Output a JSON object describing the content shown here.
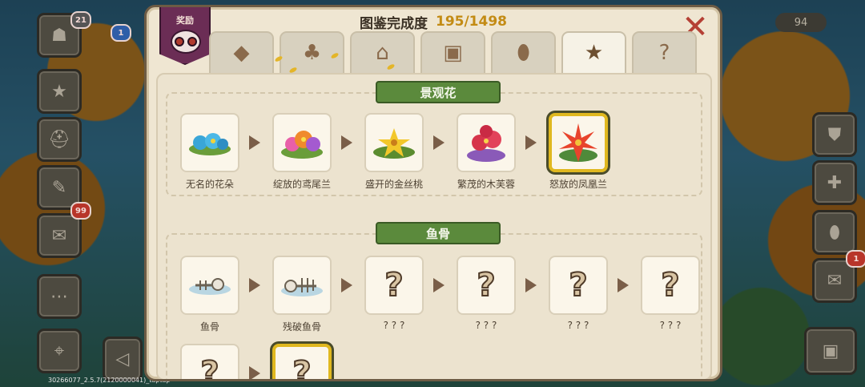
{
  "window": {
    "title": "图鉴完成度",
    "progress": "195/1498"
  },
  "reward": {
    "label": "奖励"
  },
  "background": {
    "hud_count": "94",
    "badges": [
      "21",
      "1",
      "99",
      "1"
    ],
    "version": "30266077_2.5.7(2120000041)_taptap"
  },
  "tabs": [
    {
      "icon": "gem-icon",
      "glyph": "◆",
      "active": false
    },
    {
      "icon": "clover-icon",
      "glyph": "♣",
      "active": false
    },
    {
      "icon": "house-icon",
      "glyph": "⌂",
      "active": false
    },
    {
      "icon": "chest-icon",
      "glyph": "▣",
      "active": false
    },
    {
      "icon": "egg-icon",
      "glyph": "⬮",
      "active": false
    },
    {
      "icon": "star-icon",
      "glyph": "★",
      "active": true
    },
    {
      "icon": "question-icon",
      "glyph": "?",
      "active": false
    }
  ],
  "sections": [
    {
      "title": "景观花",
      "items": [
        {
          "label": "无名的花朵",
          "known": true,
          "icon": "flower-blue-icon"
        },
        {
          "label": "绽放的鸢尾兰",
          "known": true,
          "icon": "flower-iris-icon"
        },
        {
          "label": "盛开的金丝桃",
          "known": true,
          "icon": "flower-gold-icon"
        },
        {
          "label": "繁茂的木芙蓉",
          "known": true,
          "icon": "flower-hibiscus-icon"
        },
        {
          "label": "怒放的凤凰兰",
          "known": true,
          "icon": "flower-phoenix-icon",
          "max": true
        }
      ]
    },
    {
      "title": "鱼骨",
      "items": [
        {
          "label": "鱼骨",
          "known": true,
          "icon": "fishbone-icon"
        },
        {
          "label": "残破鱼骨",
          "known": true,
          "icon": "broken-fishbone-icon"
        },
        {
          "label": "? ? ?",
          "known": false
        },
        {
          "label": "? ? ?",
          "known": false
        },
        {
          "label": "? ? ?",
          "known": false
        },
        {
          "label": "? ? ?",
          "known": false
        }
      ]
    }
  ],
  "colors": {
    "accent": "#c38b14",
    "banner": "#5b8a3c",
    "close": "#b54035",
    "gold_frame": "#e0b81f"
  }
}
